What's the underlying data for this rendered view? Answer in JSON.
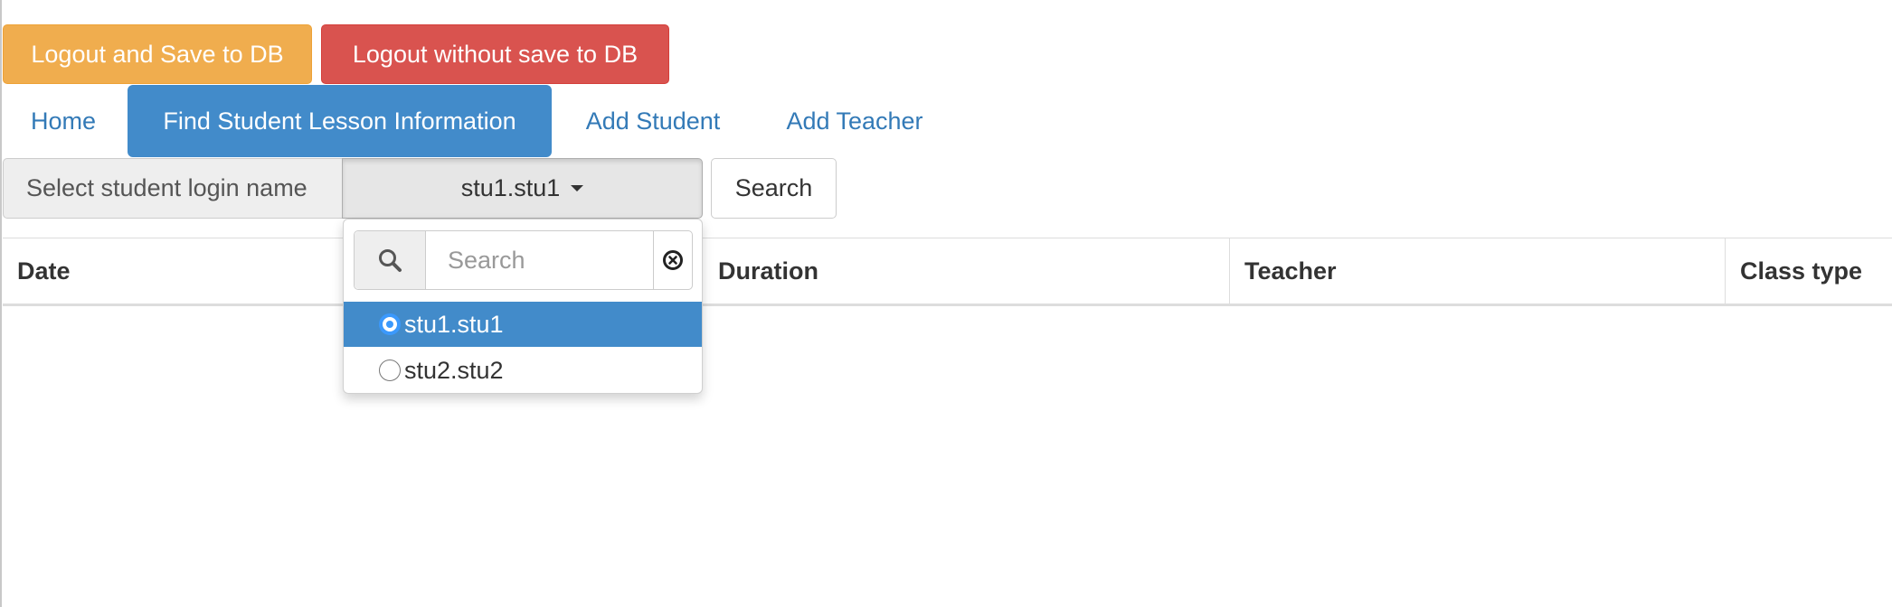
{
  "top_buttons": {
    "logout_save": "Logout and Save to DB",
    "logout_no_save": "Logout without save to DB"
  },
  "nav": {
    "items": [
      {
        "label": "Home",
        "active": false
      },
      {
        "label": "Find Student Lesson Information",
        "active": true
      },
      {
        "label": "Add Student",
        "active": false
      },
      {
        "label": "Add Teacher",
        "active": false
      }
    ]
  },
  "filter": {
    "label": "Select student login name",
    "selected_value": "stu1.stu1",
    "search_button": "Search"
  },
  "dropdown": {
    "open": true,
    "search_placeholder": "Search",
    "search_value": "",
    "options": [
      {
        "label": "stu1.stu1",
        "selected": true
      },
      {
        "label": "stu2.stu2",
        "selected": false
      }
    ]
  },
  "table": {
    "columns": [
      "Date",
      "Duration",
      "Teacher",
      "Class type"
    ],
    "rows": []
  },
  "colors": {
    "warning": "#f0ad4e",
    "danger": "#d9534f",
    "primary": "#428bca",
    "link": "#337ab7",
    "radio_accent": "#3b99fc"
  },
  "icons": {
    "search_addon": "magnifier-icon",
    "clear": "clear-circle-icon",
    "select_caret": "caret-down-icon"
  }
}
